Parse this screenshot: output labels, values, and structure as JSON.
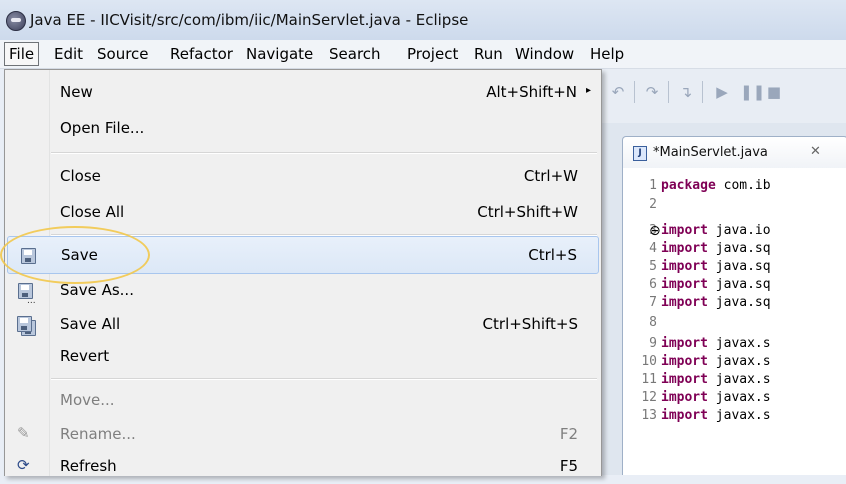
{
  "window": {
    "title": "Java EE - IICVisit/src/com/ibm/iic/MainServlet.java - Eclipse"
  },
  "menubar": [
    "File",
    "Edit",
    "Source",
    "Refactor",
    "Navigate",
    "Search",
    "Project",
    "Run",
    "Window",
    "Help"
  ],
  "file_menu": {
    "new": {
      "label": "New",
      "accel": "Alt+Shift+N",
      "submenu_arrow": "▸"
    },
    "open_file": {
      "label": "Open File..."
    },
    "close": {
      "label": "Close",
      "accel": "Ctrl+W"
    },
    "close_all": {
      "label": "Close All",
      "accel": "Ctrl+Shift+W"
    },
    "save": {
      "label": "Save",
      "accel": "Ctrl+S",
      "icon": "save-icon"
    },
    "save_as": {
      "label": "Save As...",
      "icon": "save-as-icon"
    },
    "save_all": {
      "label": "Save All",
      "accel": "Ctrl+Shift+S",
      "icon": "save-all-icon"
    },
    "revert": {
      "label": "Revert"
    },
    "move": {
      "label": "Move..."
    },
    "rename": {
      "label": "Rename...",
      "accel": "F2",
      "icon": "rename-icon"
    },
    "refresh": {
      "label": "Refresh",
      "accel": "F5",
      "icon": "refresh-icon"
    }
  },
  "editor": {
    "tab_label": "*MainServlet.java",
    "tab_close": "✕",
    "lines": [
      {
        "n": "1",
        "kw": "package",
        "rest": " com.ib"
      },
      {
        "n": "2",
        "kw": "",
        "rest": ""
      },
      {
        "n": "3",
        "kw": "import",
        "rest": " java.io",
        "fold": "⊖"
      },
      {
        "n": "4",
        "kw": "import",
        "rest": " java.sq"
      },
      {
        "n": "5",
        "kw": "import",
        "rest": " java.sq"
      },
      {
        "n": "6",
        "kw": "import",
        "rest": " java.sq"
      },
      {
        "n": "7",
        "kw": "import",
        "rest": " java.sq"
      },
      {
        "n": "8",
        "kw": "",
        "rest": ""
      },
      {
        "n": "9",
        "kw": "import",
        "rest": " javax.s"
      },
      {
        "n": "10",
        "kw": "import",
        "rest": " javax.s"
      },
      {
        "n": "11",
        "kw": "import",
        "rest": " javax.s"
      },
      {
        "n": "12",
        "kw": "import",
        "rest": " javax.s"
      },
      {
        "n": "13",
        "kw": "import",
        "rest": " javax.s"
      }
    ]
  },
  "colors": {
    "keyword": "#7f0055",
    "highlight_ring": "#f2c84b"
  }
}
